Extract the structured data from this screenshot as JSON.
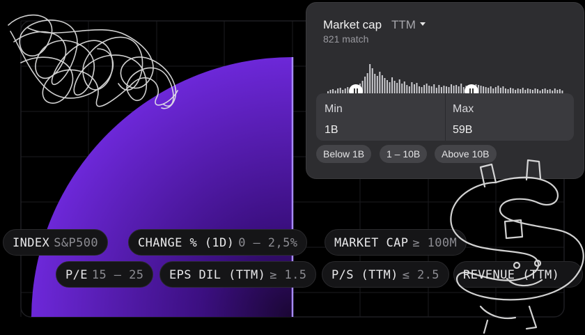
{
  "colors": {
    "accent": "#6d28d9",
    "accent_light": "#8b5cf6",
    "panel": "#2d2d30",
    "chip_bg": "#151517"
  },
  "popup": {
    "title": "Market cap",
    "period": "TTM",
    "period_icon": "caret-down-icon",
    "match_count": "821 match",
    "histogram": [
      5,
      7,
      8,
      6,
      9,
      10,
      7,
      9,
      11,
      8,
      10,
      14,
      12,
      16,
      20,
      26,
      31,
      44,
      38,
      30,
      27,
      33,
      28,
      24,
      21,
      18,
      25,
      20,
      17,
      22,
      16,
      19,
      14,
      12,
      18,
      15,
      17,
      12,
      11,
      14,
      16,
      13,
      12,
      15,
      10,
      14,
      11,
      13,
      12,
      11,
      15,
      13,
      14,
      12,
      16,
      11,
      13,
      10,
      12,
      9,
      15,
      14,
      13,
      12,
      11,
      10,
      12,
      9,
      11,
      13,
      10,
      12,
      9,
      8,
      10,
      9,
      7,
      9,
      8,
      10,
      7,
      9,
      8,
      7,
      9,
      8,
      6,
      8,
      9,
      7,
      8,
      6,
      9,
      7,
      8,
      6
    ],
    "range_min_fraction": 0.12,
    "range_max_fraction": 0.61,
    "min_label": "Min",
    "min_value": "1B",
    "max_label": "Max",
    "max_value": "59B",
    "presets": [
      "Below 1B",
      "1 – 10B",
      "Above 10B"
    ]
  },
  "chips": [
    {
      "name": "INDEX",
      "value": "S&P500"
    },
    {
      "name": "CHANGE % (1D)",
      "value": "0 — 2,5%"
    },
    {
      "name": "MARKET CAP",
      "value": "≥ 100M"
    },
    {
      "name": "P/E",
      "value": "15 – 25"
    },
    {
      "name": "EPS DIL (TTM)",
      "value": "≥ 1.5"
    },
    {
      "name": "P/S (TTM)",
      "value": "≤ 2.5"
    },
    {
      "name": "REVENUE (TTM)",
      "value": ""
    }
  ]
}
